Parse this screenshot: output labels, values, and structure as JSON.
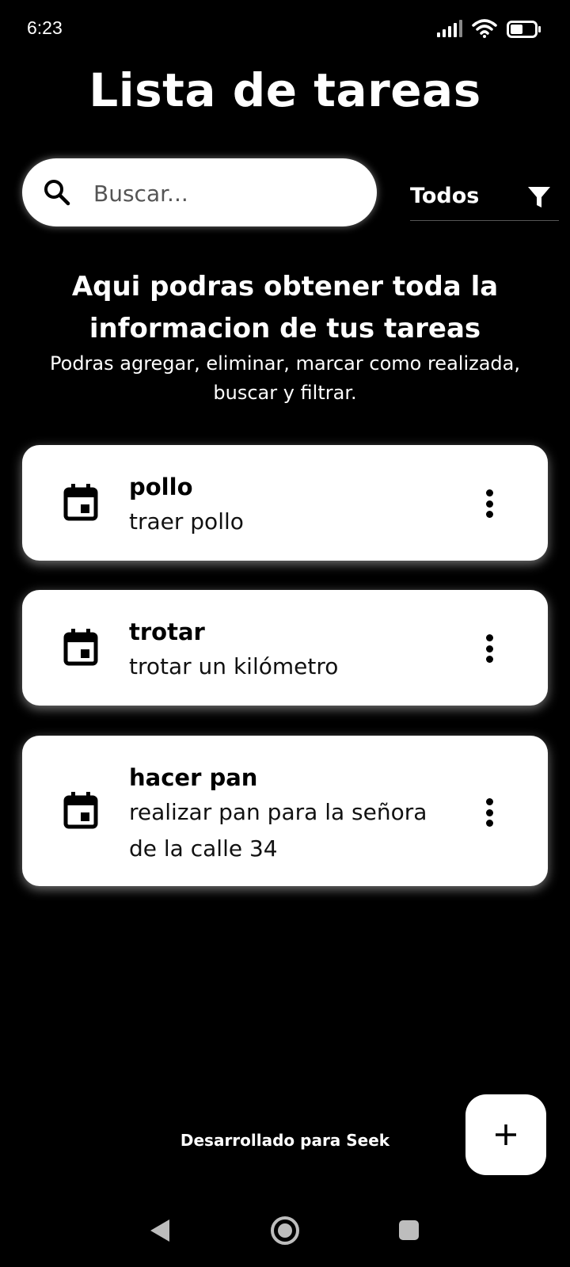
{
  "status_bar": {
    "time": "6:23",
    "icons": [
      "signal-icon",
      "wifi-icon",
      "battery-icon"
    ],
    "battery_level": "38"
  },
  "header": {
    "title": "Lista de tareas"
  },
  "search": {
    "placeholder": "Buscar...",
    "icon": "search-icon"
  },
  "filter": {
    "selected": "Todos",
    "icon": "filter-icon"
  },
  "intro": {
    "heading": "Aqui podras obtener toda la informacion de tus tareas",
    "text": "Podras agregar, eliminar, marcar como realizada, buscar y filtrar."
  },
  "tasks": [
    {
      "title": "pollo",
      "description": "traer pollo",
      "icon": "calendar-icon"
    },
    {
      "title": "trotar",
      "description": "trotar un kilómetro",
      "icon": "calendar-icon"
    },
    {
      "title": "hacer pan",
      "description": "realizar pan para la señora de la calle 34",
      "icon": "calendar-icon"
    }
  ],
  "footer": {
    "text": "Desarrollado para Seek",
    "fab_icon": "plus-icon"
  },
  "nav_bar": {
    "icons": [
      "back-icon",
      "home-icon",
      "recents-icon"
    ]
  },
  "colors": {
    "background": "#000000",
    "card": "#ffffff",
    "text_light": "#ffffff",
    "text_dark": "#000000"
  }
}
